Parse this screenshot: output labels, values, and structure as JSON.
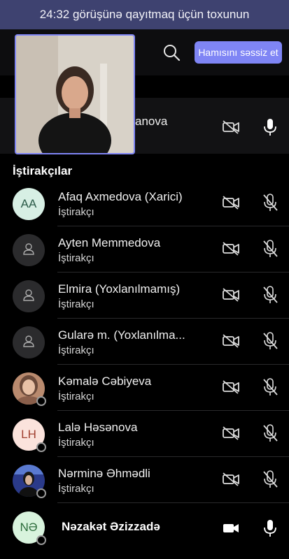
{
  "banner": {
    "text": "24:32 görüşünə qayıtmaq üçün toxunun"
  },
  "topbar": {
    "mute_all_label": "Hamısını səssiz et",
    "search_icon": "search-icon"
  },
  "presenter": {
    "name_fragment": "anova"
  },
  "participants_section": {
    "title": "İştirakçılar"
  },
  "participants": [
    {
      "name": "Afaq Axmedova (Xarici)",
      "role": "İştirakçı",
      "avatar_initials": "AA",
      "avatar_bg": "#d7efe4",
      "avatar_fg": "#2d5d4a",
      "avatar_type": "initials"
    },
    {
      "name": "Ayten Memmedova",
      "role": "İştirakçı",
      "avatar_type": "person"
    },
    {
      "name": "Elmira (Yoxlanılmamış)",
      "role": "İştirakçı",
      "avatar_type": "person"
    },
    {
      "name": "Gularə m. (Yoxlanılma...",
      "role": "İştirakçı",
      "avatar_type": "person"
    },
    {
      "name": "Kəmalə Cəbiyeva",
      "role": "İştirakçı",
      "avatar_type": "photo"
    },
    {
      "name": "Lalə Həsənova",
      "role": "İştirakçı",
      "avatar_initials": "LH",
      "avatar_bg": "#fbe3dc",
      "avatar_fg": "#a04030",
      "avatar_type": "initials"
    },
    {
      "name": "Nərminə Əhmədli",
      "role": "İştirakçı",
      "avatar_type": "photo2"
    }
  ],
  "last_participant": {
    "name": "Nəzakət Əzizzadə",
    "avatar_initials": "NƏ",
    "avatar_bg": "#d8f3dd",
    "avatar_fg": "#2b6b3a"
  },
  "colors": {
    "accent": "#7f85f5",
    "banner_bg": "#3e4270"
  }
}
